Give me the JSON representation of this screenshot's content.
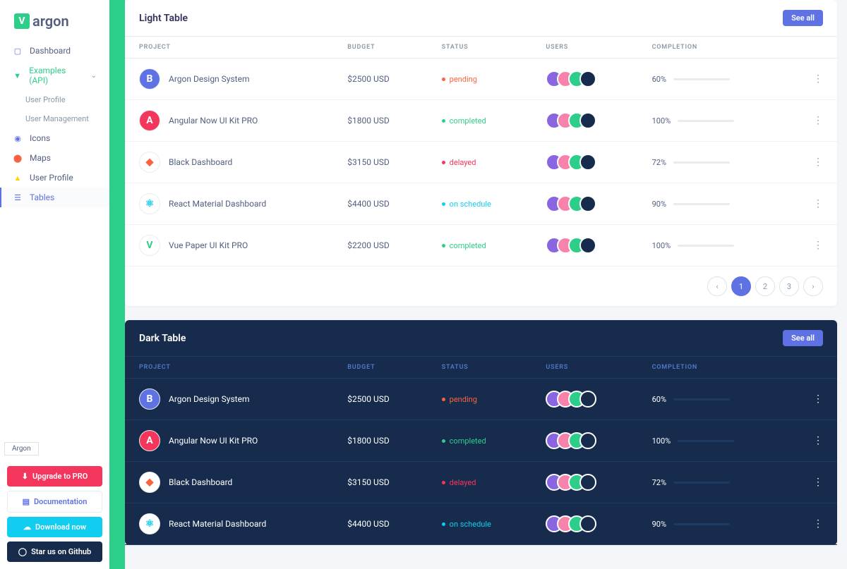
{
  "brand": "argon",
  "nav": {
    "dashboard": "Dashboard",
    "examples": "Examples (API)",
    "user_profile_sub": "User Profile",
    "user_mgmt_sub": "User Management",
    "icons": "Icons",
    "maps": "Maps",
    "user_profile": "User Profile",
    "tables": "Tables"
  },
  "buttons": {
    "upgrade": "Upgrade to PRO",
    "docs": "Documentation",
    "download": "Download now",
    "github": "Star us on Github"
  },
  "light": {
    "title": "Light Table",
    "see_all": "See all",
    "cols": {
      "project": "PROJECT",
      "budget": "BUDGET",
      "status": "STATUS",
      "users": "USERS",
      "completion": "COMPLETION"
    },
    "rows": [
      {
        "name": "Argon Design System",
        "budget": "$2500 USD",
        "status": "pending",
        "status_color": "#fb6340",
        "pct": "60%",
        "pct_val": 60,
        "bar_color": "#fb6340",
        "icon_bg": "#5e72e4",
        "icon_txt": "B"
      },
      {
        "name": "Angular Now UI Kit PRO",
        "budget": "$1800 USD",
        "status": "completed",
        "status_color": "#2dce89",
        "pct": "100%",
        "pct_val": 100,
        "bar_color": "#2dce89",
        "icon_bg": "#f5365c",
        "icon_txt": "A"
      },
      {
        "name": "Black Dashboard",
        "budget": "$3150 USD",
        "status": "delayed",
        "status_color": "#f5365c",
        "pct": "72%",
        "pct_val": 72,
        "bar_color": "#f5365c",
        "icon_bg": "#fff",
        "icon_txt": "◆",
        "icon_fg": "#fb6340"
      },
      {
        "name": "React Material Dashboard",
        "budget": "$4400 USD",
        "status": "on schedule",
        "status_color": "#11cdef",
        "pct": "90%",
        "pct_val": 90,
        "bar_color": "#11cdef",
        "icon_bg": "#fff",
        "icon_txt": "⚛",
        "icon_fg": "#11cdef"
      },
      {
        "name": "Vue Paper UI Kit PRO",
        "budget": "$2200 USD",
        "status": "completed",
        "status_color": "#2dce89",
        "pct": "100%",
        "pct_val": 100,
        "bar_color": "#2dce89",
        "icon_bg": "#fff",
        "icon_txt": "V",
        "icon_fg": "#2dce89"
      }
    ],
    "pages": [
      "1",
      "2",
      "3"
    ]
  },
  "dark": {
    "title": "Dark Table",
    "see_all": "See all",
    "cols": {
      "project": "PROJECT",
      "budget": "BUDGET",
      "status": "STATUS",
      "users": "USERS",
      "completion": "COMPLETION"
    },
    "rows": [
      {
        "name": "Argon Design System",
        "budget": "$2500 USD",
        "status": "pending",
        "status_color": "#fb6340",
        "pct": "60%",
        "pct_val": 60,
        "bar_color": "#fb6340",
        "icon_bg": "#5e72e4",
        "icon_txt": "B"
      },
      {
        "name": "Angular Now UI Kit PRO",
        "budget": "$1800 USD",
        "status": "completed",
        "status_color": "#2dce89",
        "pct": "100%",
        "pct_val": 100,
        "bar_color": "#2dce89",
        "icon_bg": "#f5365c",
        "icon_txt": "A"
      },
      {
        "name": "Black Dashboard",
        "budget": "$3150 USD",
        "status": "delayed",
        "status_color": "#f5365c",
        "pct": "72%",
        "pct_val": 72,
        "bar_color": "#f5365c",
        "icon_bg": "#fff",
        "icon_txt": "◆",
        "icon_fg": "#fb6340"
      },
      {
        "name": "React Material Dashboard",
        "budget": "$4400 USD",
        "status": "on schedule",
        "status_color": "#11cdef",
        "pct": "90%",
        "pct_val": 90,
        "bar_color": "#11cdef",
        "icon_bg": "#fff",
        "icon_txt": "⚛",
        "icon_fg": "#11cdef"
      }
    ]
  },
  "avatar_colors": [
    "#8965e0",
    "#f783ac",
    "#2dce89",
    "#172b4d"
  ],
  "footer_tag": "Argon"
}
